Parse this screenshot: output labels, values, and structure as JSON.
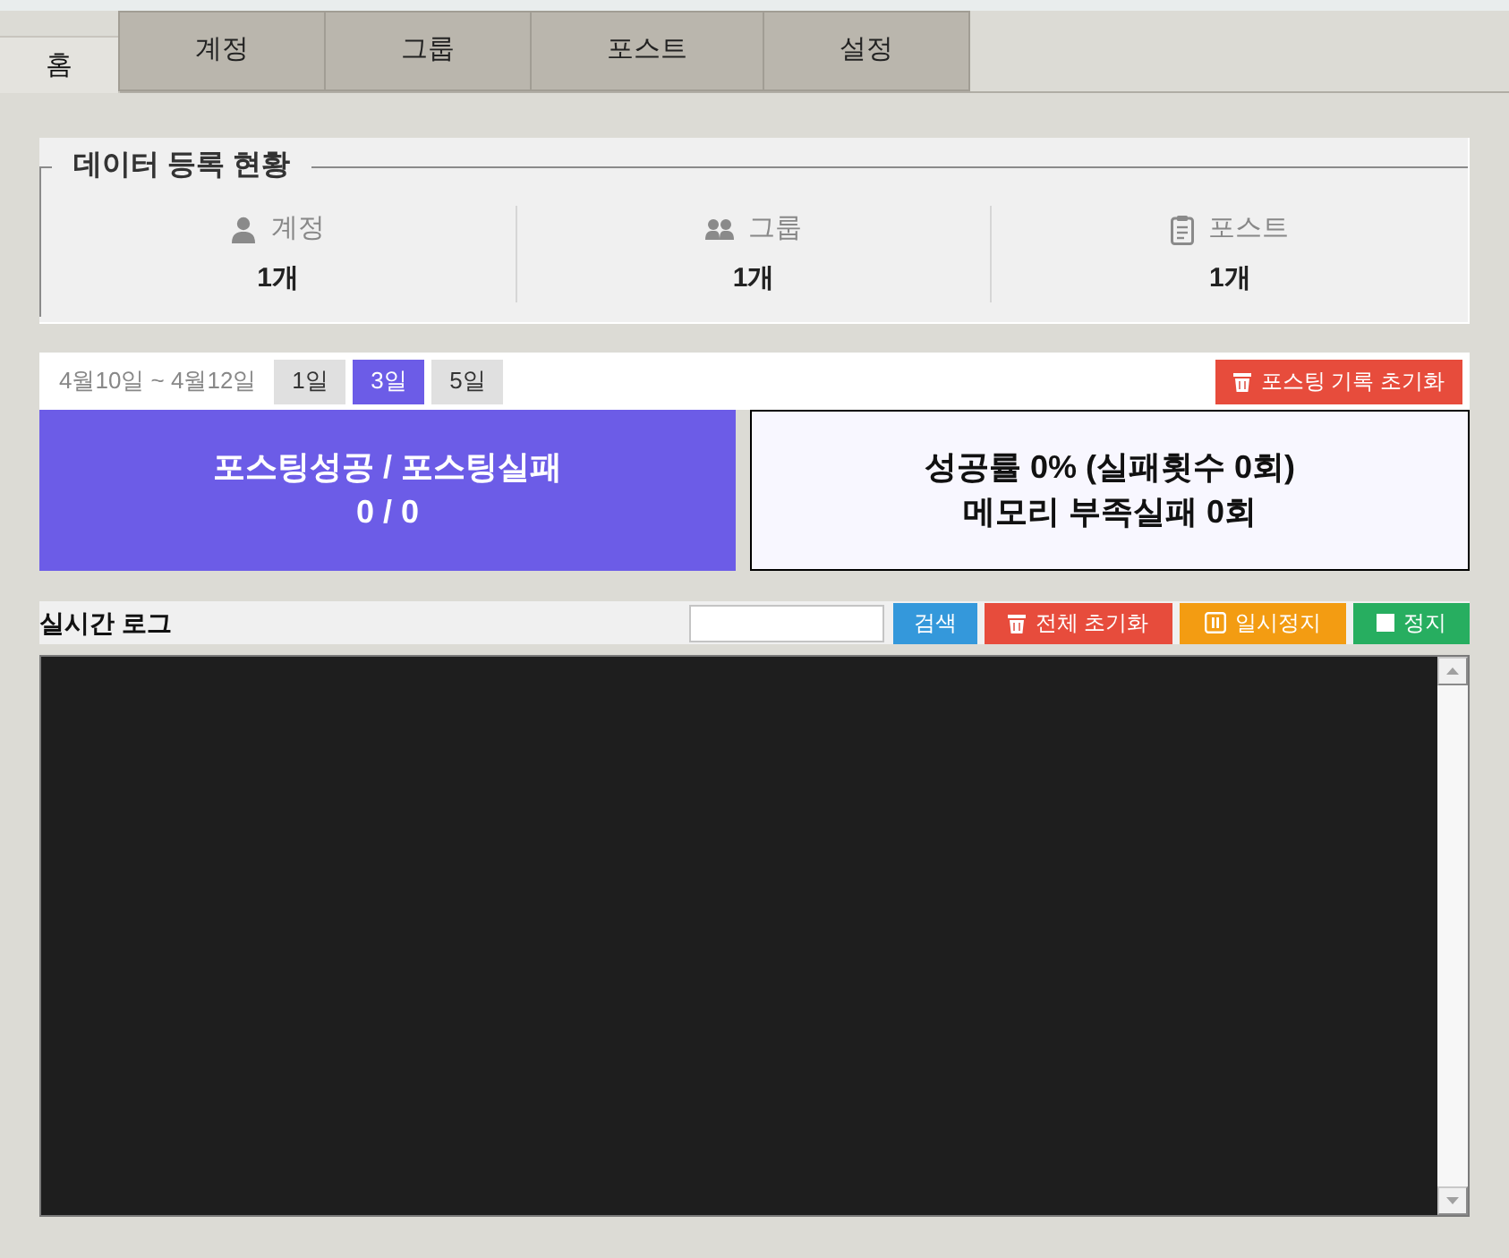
{
  "tabs": [
    {
      "label": "홈",
      "selected": true
    },
    {
      "label": "계정",
      "selected": false
    },
    {
      "label": "그룹",
      "selected": false
    },
    {
      "label": "포스트",
      "selected": false
    },
    {
      "label": "설정",
      "selected": false
    }
  ],
  "registration": {
    "title": "데이터 등록 현황",
    "items": [
      {
        "kind": "account",
        "label": "계정",
        "count": "1개"
      },
      {
        "kind": "group",
        "label": "그룹",
        "count": "1개"
      },
      {
        "kind": "post",
        "label": "포스트",
        "count": "1개"
      }
    ]
  },
  "posting": {
    "date_range": "4월10일 ~ 4월12일",
    "periods": [
      {
        "label": "1일",
        "selected": false
      },
      {
        "label": "3일",
        "selected": true
      },
      {
        "label": "5일",
        "selected": false
      }
    ],
    "reset_button": "포스팅 기록 초기화",
    "result": {
      "title": "포스팅성공 / 포스팅실패",
      "value": "0 / 0"
    },
    "rate": {
      "lines": [
        "성공률 0% (실패횟수 0회)",
        "메모리 부족실패 0회"
      ]
    }
  },
  "log": {
    "title": "실시간 로그",
    "buttons": [
      {
        "kind": "search",
        "label": "검색"
      },
      {
        "kind": "clear",
        "label": "전체 초기화"
      },
      {
        "kind": "pause",
        "label": "일시정지"
      },
      {
        "kind": "stop",
        "label": "정지"
      }
    ]
  }
}
